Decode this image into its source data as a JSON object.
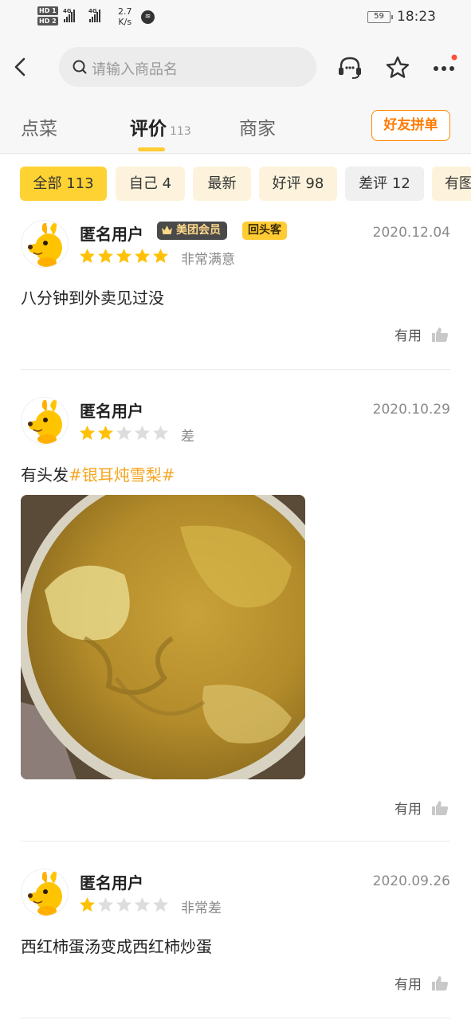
{
  "status_bar": {
    "hd1": "HD 1",
    "hd2": "HD 2",
    "signal1": "4G",
    "signal2": "4G",
    "speed": "2.7",
    "speed_unit": "K/s",
    "battery": "59",
    "time": "18:23"
  },
  "nav": {
    "search_placeholder": "请输入商品名"
  },
  "tabs": {
    "items": [
      {
        "label": "点菜"
      },
      {
        "label": "评价",
        "count": "113"
      },
      {
        "label": "商家"
      }
    ],
    "friend_button": "好友拼单"
  },
  "filters": [
    {
      "label": "全部 113"
    },
    {
      "label": "自己 4"
    },
    {
      "label": "最新"
    },
    {
      "label": "好评 98"
    },
    {
      "label": "差评 12"
    },
    {
      "label": "有图"
    }
  ],
  "reviews": [
    {
      "username": "匿名用户",
      "badge_member": "美团会员",
      "badge_return": "回头客",
      "date": "2020.12.04",
      "stars": 5,
      "rating_label": "非常满意",
      "text": "八分钟到外卖见过没",
      "useful": "有用"
    },
    {
      "username": "匿名用户",
      "date": "2020.10.29",
      "stars": 2,
      "rating_label": "差",
      "text": "有头发",
      "hashtag": "#银耳炖雪梨#",
      "useful": "有用"
    },
    {
      "username": "匿名用户",
      "date": "2020.09.26",
      "stars": 1,
      "rating_label": "非常差",
      "text": "西红柿蛋汤变成西红柿炒蛋",
      "useful": "有用"
    }
  ],
  "colors": {
    "accent_yellow": "#ffcc33",
    "star_filled": "#ffc107",
    "star_empty": "#dddddd",
    "hashtag": "#f5a623",
    "friend_button": "#ff7a00"
  }
}
